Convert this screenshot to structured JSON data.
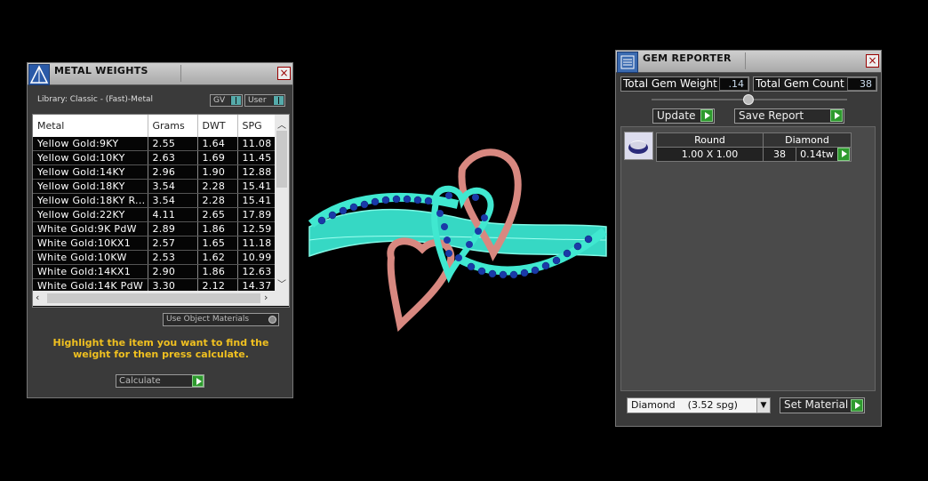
{
  "metal_weights": {
    "title": "METAL WEIGHTS",
    "library_label": "Library: Classic - (Fast)-Metal",
    "gv_label": "GV",
    "user_label": "User",
    "columns": [
      "Metal",
      "Grams",
      "DWT",
      "SPG"
    ],
    "rows": [
      [
        "Yellow Gold:9KY",
        "2.55",
        "1.64",
        "11.08"
      ],
      [
        "Yellow Gold:10KY",
        "2.63",
        "1.69",
        "11.45"
      ],
      [
        "Yellow Gold:14KY",
        "2.96",
        "1.90",
        "12.88"
      ],
      [
        "Yellow Gold:18KY",
        "3.54",
        "2.28",
        "15.41"
      ],
      [
        "Yellow Gold:18KY R...",
        "3.54",
        "2.28",
        "15.41"
      ],
      [
        "Yellow Gold:22KY",
        "4.11",
        "2.65",
        "17.89"
      ],
      [
        "White Gold:9K PdW",
        "2.89",
        "1.86",
        "12.59"
      ],
      [
        "White Gold:10KX1",
        "2.57",
        "1.65",
        "11.18"
      ],
      [
        "White Gold:10KW",
        "2.53",
        "1.62",
        "10.99"
      ],
      [
        "White Gold:14KX1",
        "2.90",
        "1.86",
        "12.63"
      ],
      [
        "White Gold:14K PdW",
        "3.30",
        "2.12",
        "14.37"
      ]
    ],
    "use_object_materials_label": "Use Object Materials",
    "instruction": "Highlight the item you want to find the weight for then press calculate.",
    "calculate_label": "Calculate"
  },
  "gem_reporter": {
    "title": "GEM REPORTER",
    "total_gem_weight_label": "Total Gem Weight",
    "total_gem_weight_value": ".14",
    "total_gem_count_label": "Total Gem Count",
    "total_gem_count_value": "38",
    "update_label": "Update",
    "save_report_label": "Save Report",
    "gem_row": {
      "shape": "Round",
      "material": "Diamond",
      "size": "1.00 X 1.00",
      "count": "38",
      "weight": "0.14tw"
    },
    "material_select": "Diamond    (3.52 spg)",
    "set_material_label": "Set Material"
  },
  "colors": {
    "accent_yellow": "#f0c020",
    "ring_metal": "#40e8d0",
    "ring_gems": "#1a3aa8",
    "ring_hearts": "#d88880"
  }
}
